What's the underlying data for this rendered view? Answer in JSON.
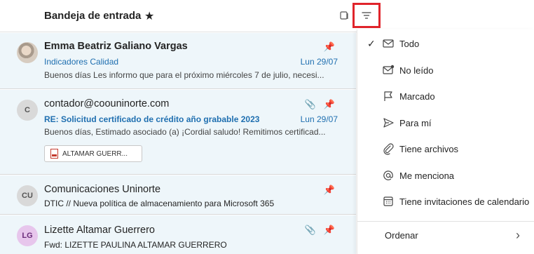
{
  "header": {
    "title": "Bandeja de entrada",
    "favorite_icon": "star-icon",
    "filter_icon": "filter-icon"
  },
  "messages": [
    {
      "sender": "Emma Beatriz Galiano Vargas",
      "subject": "Indicadores Calidad",
      "date": "Lun 29/07",
      "preview": "Buenos días Les informo que para el próximo miércoles 7 de julio, necesi...",
      "pinned": true
    },
    {
      "avatar": "C",
      "sender": "contador@coouninorte.com",
      "subject": "RE: Solicitud certificado de crédito año grabable 2023",
      "date": "Lun 29/07",
      "preview": "Buenos días, Estimado asociado (a) ¡Cordial saludo! Remitimos certificad...",
      "attachment": "ALTAMAR GUERR...",
      "pinned": true,
      "has_attachment": true
    },
    {
      "avatar": "CU",
      "sender": "Comunicaciones Uninorte",
      "subject": "DTIC // Nueva política de almacenamiento para Microsoft 365",
      "pinned": true
    },
    {
      "avatar": "LG",
      "sender": "Lizette Altamar Guerrero",
      "subject": "Fwd: LIZETTE PAULINA ALTAMAR GUERRERO",
      "pinned": true,
      "has_attachment": true
    }
  ],
  "filter_menu": {
    "items": [
      {
        "label": "Todo",
        "icon": "mail-icon",
        "checked": true
      },
      {
        "label": "No leído",
        "icon": "unread-mail-icon"
      },
      {
        "label": "Marcado",
        "icon": "flag-icon"
      },
      {
        "label": "Para mí",
        "icon": "send-icon"
      },
      {
        "label": "Tiene archivos",
        "icon": "paperclip-icon"
      },
      {
        "label": "Me menciona",
        "icon": "at-icon"
      },
      {
        "label": "Tiene invitaciones de calendario",
        "icon": "calendar-icon"
      }
    ],
    "sort_label": "Ordenar"
  },
  "colors": {
    "accent": "#1f6fb0",
    "highlight_border": "#e0242b",
    "list_background": "#eef6fa"
  }
}
